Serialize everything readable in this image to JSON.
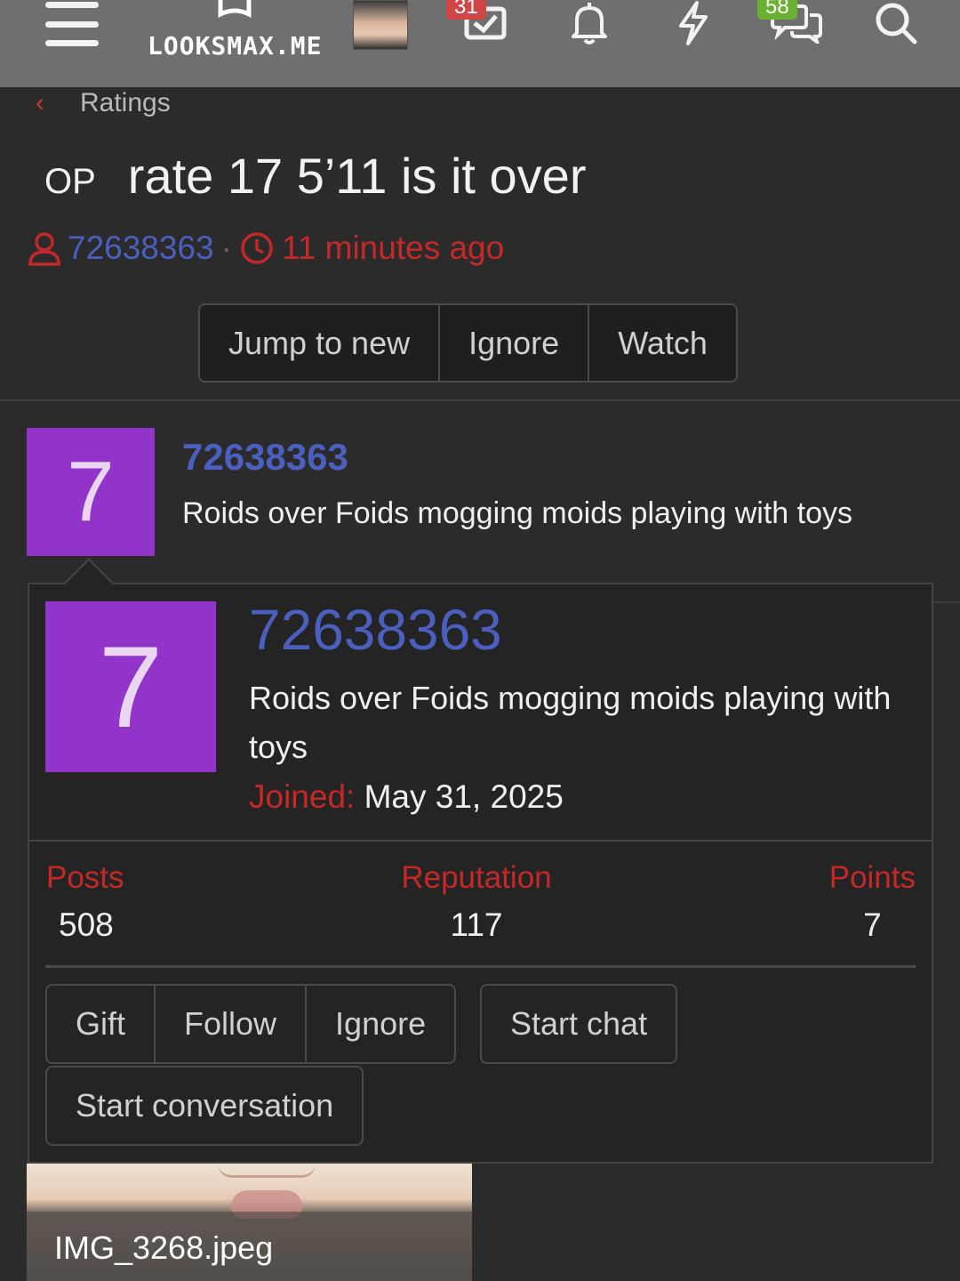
{
  "nav": {
    "logo_text": "LOOKSMAX.ME",
    "inbox_count": "31",
    "chat_count": "58",
    "icons": [
      "menu-icon",
      "inbox-icon",
      "bell-icon",
      "bolt-icon",
      "chat-bubbles-icon",
      "search-icon"
    ],
    "badge_colors": {
      "inbox": "#d04545",
      "chat": "#6ab033"
    }
  },
  "breadcrumb": {
    "label": "Ratings"
  },
  "thread": {
    "op_tag": "OP",
    "title": "rate 17 5’11 is it over",
    "author": "72638363",
    "separator": "·",
    "time": "11 minutes ago"
  },
  "thread_actions": {
    "jump": "Jump to new",
    "ignore": "Ignore",
    "watch": "Watch"
  },
  "post": {
    "avatar_letter": "7",
    "username": "72638363",
    "tagline": "Roids over Foids mogging moids playing with toys",
    "avatar_color": "#9233c9"
  },
  "member_card": {
    "avatar_letter": "7",
    "username": "72638363",
    "tagline": "Roids over Foids mogging moids playing with toys",
    "joined_label": "Joined:",
    "joined_value": "May 31, 2025",
    "stats": {
      "posts_label": "Posts",
      "posts_value": "508",
      "reputation_label": "Reputation",
      "reputation_value": "117",
      "points_label": "Points",
      "points_value": "7"
    },
    "actions": {
      "gift": "Gift",
      "follow": "Follow",
      "ignore": "Ignore",
      "start_chat": "Start chat",
      "start_conversation": "Start conversation"
    }
  },
  "attachment": {
    "filename": "IMG_3268.jpeg"
  },
  "colors": {
    "link_blue": "#4b5fbf",
    "accent_red": "#c62828"
  }
}
